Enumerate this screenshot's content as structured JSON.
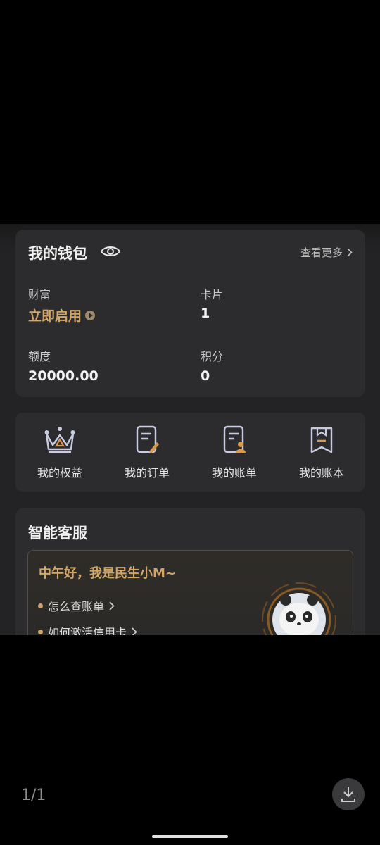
{
  "wallet": {
    "title": "我的钱包",
    "more_label": "查看更多",
    "wealth_label": "财富",
    "wealth_value": "立即启用",
    "card_label": "卡片",
    "card_value": "1",
    "limit_label": "额度",
    "limit_value": "20000.00",
    "points_label": "积分",
    "points_value": "0"
  },
  "actions": [
    {
      "label": "我的权益",
      "icon": "crown-icon"
    },
    {
      "label": "我的订单",
      "icon": "order-edit-icon"
    },
    {
      "label": "我的账单",
      "icon": "bill-user-icon"
    },
    {
      "label": "我的账本",
      "icon": "ledger-icon"
    }
  ],
  "service": {
    "title": "智能客服",
    "greeting": "中午好，我是民生小M~",
    "faqs": [
      "怎么查账单",
      "如何激活信用卡"
    ]
  },
  "viewer": {
    "page_indicator": "1/1",
    "download_icon": "download-icon"
  },
  "colors": {
    "gold": "#d2a667",
    "card_bg": "#2c2c2e",
    "screen_bg": "#232325"
  }
}
